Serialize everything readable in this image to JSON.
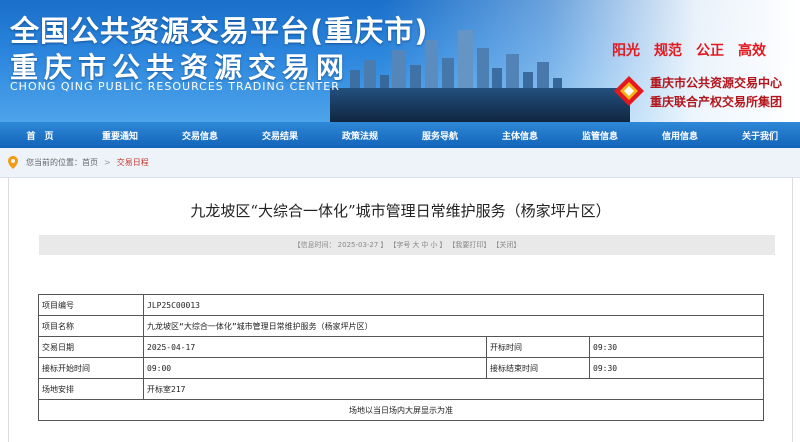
{
  "banner": {
    "title_main": "全国公共资源交易平台(重庆市)",
    "title_sub": "重庆市公共资源交易网",
    "title_en": "CHONG QING PUBLIC RESOURCES TRADING CENTER",
    "slogans": [
      "阳光",
      "规范",
      "公正",
      "高效"
    ],
    "org_name_1": "重庆市公共资源交易中心",
    "org_name_2": "重庆联合产权交易所集团",
    "slogan_color": "#e3191f"
  },
  "nav": {
    "items": [
      "首　页",
      "重要通知",
      "交易信息",
      "交易结果",
      "政策法规",
      "服务导航",
      "主体信息",
      "监管信息",
      "信用信息",
      "关于我们"
    ],
    "color": "#1264b8"
  },
  "breadcrumb": {
    "prefix": "您当前的位置：",
    "home": "首页",
    "separator": ">",
    "current": "交易日程"
  },
  "article": {
    "title": "九龙坡区“大综合一体化”城市管理日常维护服务（杨家坪片区）",
    "info": {
      "date_prefix": "【信息时间：",
      "date": "2025-03-27",
      "date_suffix": "】",
      "font_prefix": "【字号",
      "font_large": "大",
      "font_medium": "中",
      "font_small": "小",
      "font_suffix": "】",
      "print": "【我要打印】",
      "close": "【关闭】"
    }
  },
  "schedule": {
    "project_no_label": "项目编号",
    "project_no": "JLP25C00013",
    "project_name_label": "项目名称",
    "project_name": "九龙坡区“大综合一体化”城市管理日常维护服务（杨家坪片区）",
    "trade_date_label": "交易日期",
    "trade_date": "2025-04-17",
    "open_time_label": "开标时间",
    "open_time": "09:30",
    "bid_start_label": "接标开始时间",
    "bid_start": "09:00",
    "bid_end_label": "接标结束时间",
    "bid_end": "09:30",
    "venue_label": "场地安排",
    "venue": "开标室217",
    "note": "场地以当日场内大屏显示为准"
  }
}
